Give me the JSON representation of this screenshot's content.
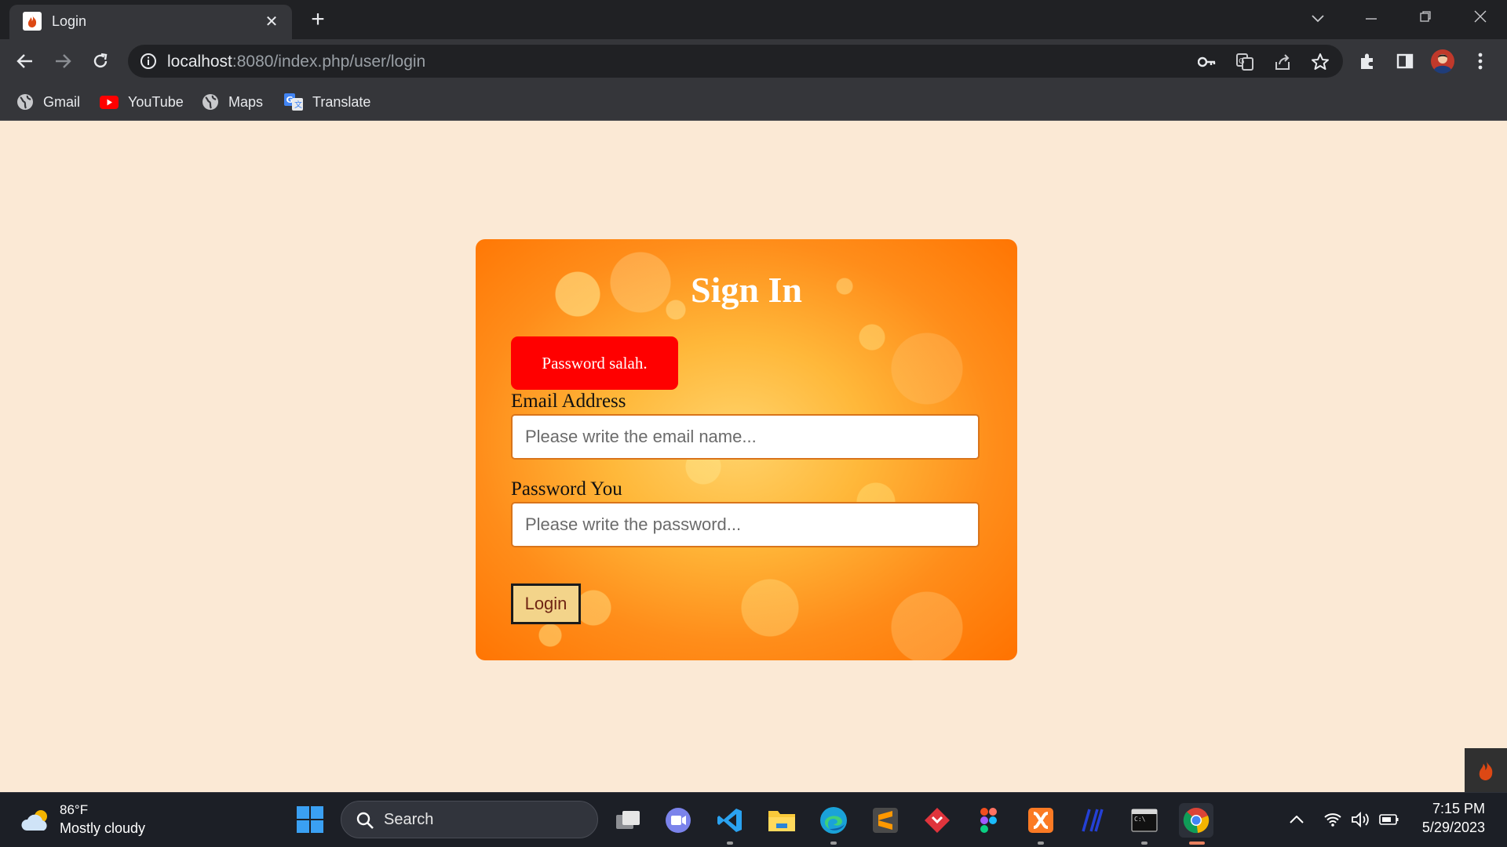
{
  "browser": {
    "tab_title": "Login",
    "url_host": "localhost",
    "url_rest": ":8080/index.php/user/login",
    "bookmarks": [
      {
        "label": "Gmail",
        "icon": "globe-icon"
      },
      {
        "label": "YouTube",
        "icon": "youtube-icon"
      },
      {
        "label": "Maps",
        "icon": "globe-icon"
      },
      {
        "label": "Translate",
        "icon": "translate-icon"
      }
    ]
  },
  "page": {
    "title": "Sign In",
    "alert": "Password salah.",
    "email_label": "Email Address",
    "email_placeholder": "Please write the email name...",
    "password_label": "Password You",
    "password_placeholder": "Please write the password...",
    "login_button": "Login"
  },
  "taskbar": {
    "weather_temp": "86°F",
    "weather_desc": "Mostly cloudy",
    "search_label": "Search",
    "time": "7:15 PM",
    "date": "5/29/2023"
  },
  "colors": {
    "page_bg": "#fbe9d5",
    "alert_bg": "#ff0000",
    "card_orange": "#ff7a00",
    "button_bg": "#f3d48a",
    "button_text": "#6f2414"
  }
}
